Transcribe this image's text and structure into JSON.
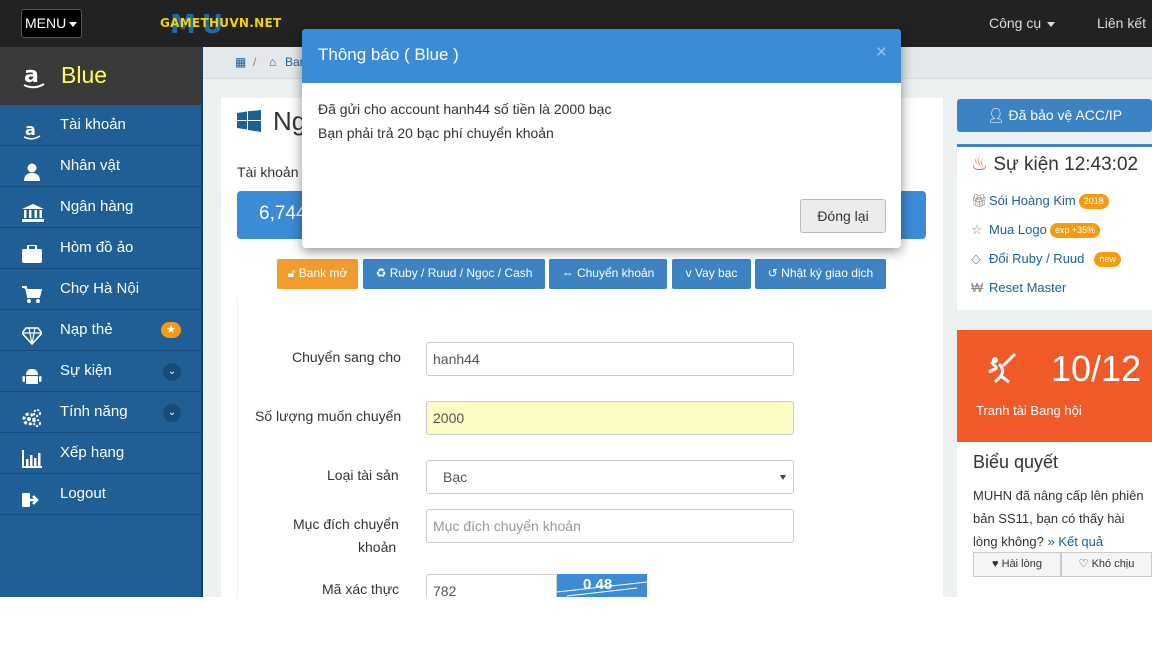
{
  "topbar": {
    "menu_label": "MENU",
    "logo_main": "MU",
    "logo_sub": "GAMETHUVN.NET",
    "tools_label": "Công cụ",
    "links_label": "Liên kết"
  },
  "sidebar": {
    "brand": "Blue",
    "items": [
      {
        "label": "Tài khoản",
        "icon": "amazon-icon"
      },
      {
        "label": "Nhân vật",
        "icon": "user-icon"
      },
      {
        "label": "Ngân hàng",
        "icon": "bank-icon"
      },
      {
        "label": "Hòm đồ ảo",
        "icon": "briefcase-icon"
      },
      {
        "label": "Chợ Hà Nội",
        "icon": "cart-icon"
      },
      {
        "label": "Nạp thẻ",
        "icon": "diamond-icon",
        "badge": "★"
      },
      {
        "label": "Sự kiện",
        "icon": "android-icon"
      },
      {
        "label": "Tính năng",
        "icon": "cogs-icon"
      },
      {
        "label": "Xếp hạng",
        "icon": "bar-chart-icon"
      },
      {
        "label": "Logout",
        "icon": "sign-out-icon"
      }
    ]
  },
  "breadcrumb": {
    "home_sep": "/",
    "bank": "Ban"
  },
  "main": {
    "title": "Ng",
    "account_label": "Tài khoản",
    "balance": "6,744",
    "buttons": [
      {
        "label": "Bank mở",
        "icon": "lock-icon"
      },
      {
        "label": "Ruby / Ruud / Ngọc / Cash",
        "icon": "recycle-icon"
      },
      {
        "label": "Chuyển khoản",
        "icon": "exchange-icon"
      },
      {
        "label": "Vay bạc",
        "icon": "vimeo-icon"
      },
      {
        "label": "Nhật ký giao dịch",
        "icon": "history-icon"
      }
    ],
    "form": {
      "to_label": "Chuyển sang cho",
      "to_value": "hanh44",
      "amount_label": "Số lượng muốn chuyển",
      "amount_value": "2000",
      "asset_label": "Loại tài sản",
      "asset_value": "Bạc",
      "purpose_label_1": "Mục đích chuyển",
      "purpose_label_2": "khoản",
      "purpose_placeholder": "Mục đích chuyển khoản",
      "captcha_label": "Mã xác thực",
      "captcha_value": "782",
      "captcha_image_text": "0 48"
    }
  },
  "right": {
    "protect_label": "Đã bảo vệ ACC/IP",
    "events_title": "Sự kiện 12:43:02",
    "events": [
      {
        "label": "Sói Hoàng Kim",
        "badge": "2018",
        "icon": "gift-icon"
      },
      {
        "label": "Mua Logo",
        "badge": "exp +35%",
        "icon": "star-icon"
      },
      {
        "label": "Đổi Ruby / Ruud",
        "badge": "new",
        "icon": "diamond-icon"
      },
      {
        "label": "Reset Master",
        "badge": "",
        "icon": "won-icon"
      }
    ],
    "war_score": "10/12",
    "war_label": "Tranh tài Bang hội",
    "poll_title": "Biểu quyết",
    "poll_text": "MUHN đã nâng cấp lên phiên bản SS11, bạn có thấy hài lòng không?",
    "poll_link": "» Kết quả",
    "poll_yes": "Hài lòng",
    "poll_no": "Khó chịu"
  },
  "modal": {
    "title": "Thông báo ( Blue )",
    "close": "×",
    "line1": "Đã gửi cho account hanh44 số tiền là 2000 bạc",
    "line2": "Bạn phải trả 20 bạc phí chuyển khoản",
    "close_button": "Đóng lại"
  },
  "colors": {
    "sidebar": "#1f5f96",
    "accent": "#3b8bd6",
    "orange": "#f39c2e",
    "war": "#f05a28"
  }
}
